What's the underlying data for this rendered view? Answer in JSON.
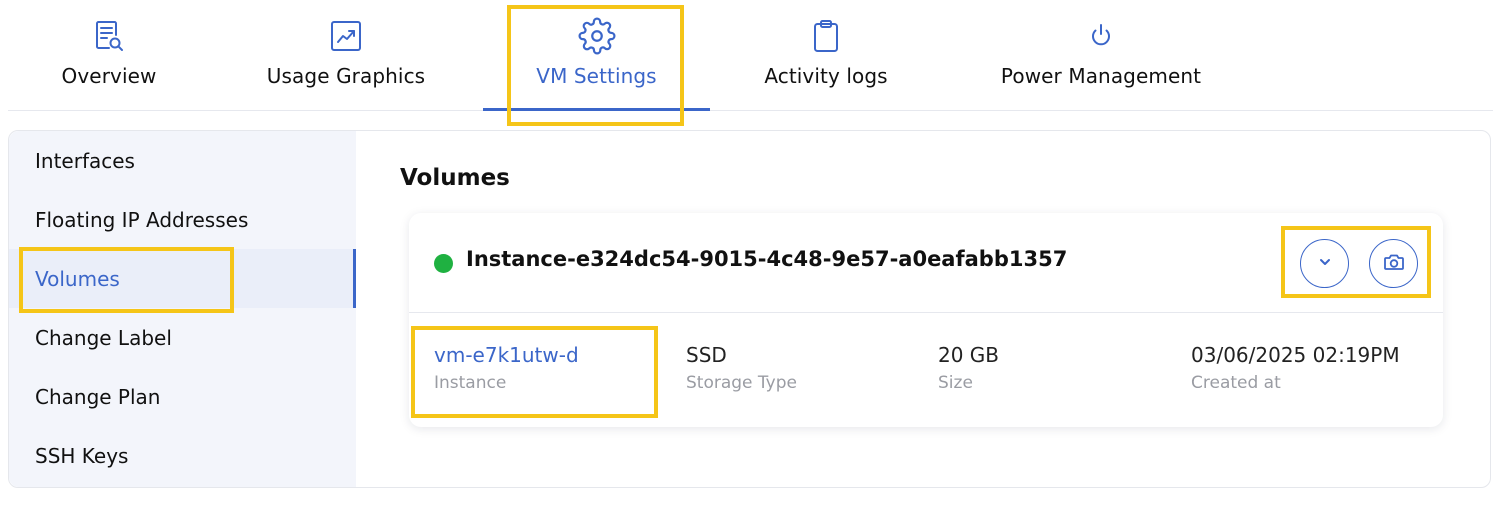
{
  "tabs": [
    {
      "label": "Overview",
      "icon": "document-search-icon"
    },
    {
      "label": "Usage Graphics",
      "icon": "chart-icon"
    },
    {
      "label": "VM Settings",
      "icon": "gear-icon"
    },
    {
      "label": "Activity logs",
      "icon": "clipboard-icon"
    },
    {
      "label": "Power Management",
      "icon": "power-icon"
    }
  ],
  "active_tab": "VM Settings",
  "sidebar": {
    "items": [
      {
        "label": "Interfaces"
      },
      {
        "label": "Floating IP Addresses"
      },
      {
        "label": "Volumes"
      },
      {
        "label": "Change Label"
      },
      {
        "label": "Change Plan"
      },
      {
        "label": "SSH Keys"
      }
    ],
    "active": "Volumes"
  },
  "volumes": {
    "title": "Volumes",
    "card": {
      "status_color": "#1fb141",
      "instance_name": "Instance-e324dc54-9015-4c48-9e57-a0eafabb1357",
      "actions": [
        {
          "icon": "chevron-down-icon"
        },
        {
          "icon": "camera-icon"
        }
      ],
      "details": [
        {
          "value": "vm-e7k1utw-d",
          "label": "Instance"
        },
        {
          "value": "SSD",
          "label": "Storage Type"
        },
        {
          "value": "20 GB",
          "label": "Size"
        },
        {
          "value": "03/06/2025 02:19PM",
          "label": "Created at"
        }
      ]
    }
  },
  "colors": {
    "accent": "#3b66c9",
    "highlight": "#f5c518",
    "status_ok": "#1fb141"
  }
}
